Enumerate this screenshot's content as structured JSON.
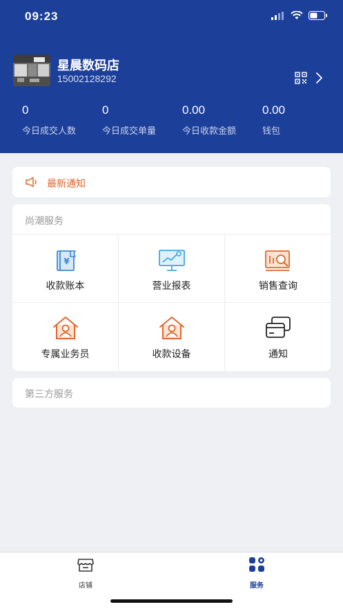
{
  "status_bar": {
    "time": "09:23"
  },
  "store": {
    "name": "星晨数码店",
    "phone": "15002128292",
    "qr_icon": "qr-code-icon",
    "arrow_icon": "chevron-right-icon"
  },
  "stats": [
    {
      "value": "0",
      "label": "今日成交人数"
    },
    {
      "value": "0",
      "label": "今日成交单量"
    },
    {
      "value": "0.00",
      "label": "今日收款金额"
    },
    {
      "value": "0.00",
      "label": "钱包"
    }
  ],
  "notice": {
    "text": "最新通知",
    "icon": "megaphone-icon"
  },
  "services": {
    "title": "尚潮服务",
    "items": [
      {
        "label": "收款账本",
        "icon": "ledger-icon"
      },
      {
        "label": "营业报表",
        "icon": "report-chart-icon"
      },
      {
        "label": "销售查询",
        "icon": "sales-search-icon"
      },
      {
        "label": "专属业务员",
        "icon": "salesperson-icon"
      },
      {
        "label": "收款设备",
        "icon": "device-icon"
      },
      {
        "label": "通知",
        "icon": "cards-icon"
      }
    ]
  },
  "third_party": {
    "title": "第三方服务"
  },
  "tabbar": {
    "items": [
      {
        "label": "店铺",
        "icon": "store-icon",
        "active": false
      },
      {
        "label": "服务",
        "icon": "service-grid-icon",
        "active": true
      }
    ]
  },
  "colors": {
    "header_bg": "#1c3f99",
    "accent_orange": "#e0662a",
    "accent_blue": "#3a87d4",
    "page_bg": "#eef0f4"
  }
}
